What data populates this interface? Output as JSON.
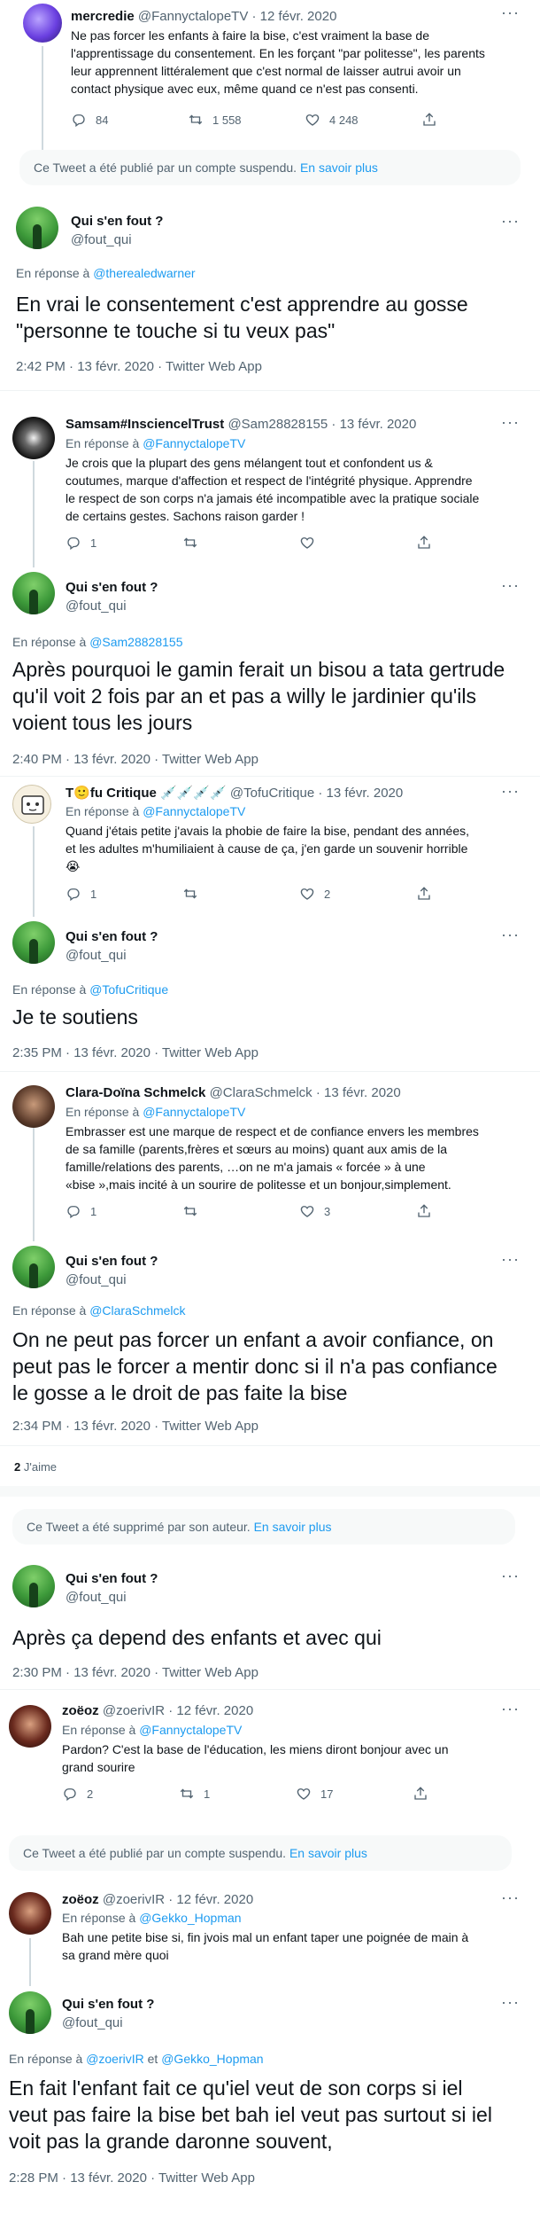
{
  "tweets": {
    "t1": {
      "name": "mercredie",
      "handle": "@FannyctalopeTV",
      "date": "· 12 févr. 2020",
      "lines": [
        "Ne pas forcer les enfants à faire la bise, c'est vraiment la base de",
        "l'apprentissage du consentement. En les forçant \"par politesse\", les parents",
        "leur apprennent littéralement que c'est normal de laisser autrui avoir un",
        "contact physique avec eux, même quand ce n'est pas consenti."
      ],
      "replies": "84",
      "retweets": "1 558",
      "likes": "4 248"
    },
    "notice1": {
      "text": "Ce Tweet a été publié par un compte suspendu.",
      "link": "En savoir plus"
    },
    "f1": {
      "name": "Qui s'en fout ?",
      "handle": "@fout_qui",
      "reply_prefix": "En réponse à",
      "reply_to": "@therealedwarner",
      "lines": [
        "En vrai le consentement c'est apprendre au gosse",
        "\"personne te touche si tu veux pas\""
      ],
      "time": "2:42 PM · 13 févr. 2020 · Twitter Web App"
    },
    "t2": {
      "name": "Samsam#InsciencelTrust",
      "handle": "@Sam28828155",
      "date": "· 13 févr. 2020",
      "reply_prefix": "En réponse à",
      "reply_to": "@FannyctalopeTV",
      "lines": [
        "Je crois que la plupart des gens mélangent tout et confondent us &",
        "coutumes, marque d'affection et respect de l'intégrité physique. Apprendre",
        "le respect de son corps n'a jamais été incompatible avec la pratique sociale",
        "de certains gestes. Sachons raison garder !"
      ],
      "replies": "1",
      "retweets": "",
      "likes": ""
    },
    "f2": {
      "name": "Qui s'en fout ?",
      "handle": "@fout_qui",
      "reply_prefix": "En réponse à",
      "reply_to": "@Sam28828155",
      "lines": [
        "Après pourquoi le gamin ferait un bisou a tata gertrude",
        "qu'il voit 2 fois par an et pas a willy le jardinier qu'ils",
        "voient tous les jours"
      ],
      "time": "2:40 PM · 13 févr. 2020 · Twitter Web App"
    },
    "t3": {
      "name": "T🙂fu Critique 💉💉💉💉",
      "handle": "@TofuCritique",
      "date": "· 13 févr. 2020",
      "reply_prefix": "En réponse à",
      "reply_to": "@FannyctalopeTV",
      "lines": [
        "Quand j'étais petite j'avais la phobie de faire la bise, pendant des années,",
        "et les adultes m'humiliaient à cause de ça, j'en garde un souvenir horrible",
        "😭"
      ],
      "replies": "1",
      "retweets": "",
      "likes": "2"
    },
    "f3": {
      "name": "Qui s'en fout ?",
      "handle": "@fout_qui",
      "reply_prefix": "En réponse à",
      "reply_to": "@TofuCritique",
      "lines": [
        "Je te soutiens"
      ],
      "time": "2:35 PM · 13 févr. 2020 · Twitter Web App"
    },
    "t4": {
      "name": "Clara-Doïna Schmelck",
      "handle": "@ClaraSchmelck",
      "date": "· 13 févr. 2020",
      "reply_prefix": "En réponse à",
      "reply_to": "@FannyctalopeTV",
      "lines": [
        "Embrasser est une marque de respect et de confiance envers les membres",
        "de sa famille (parents,frères et sœurs au moins) quant aux amis de la",
        "famille/relations des parents, …on ne m'a jamais « forcée » à une",
        "«bise »,mais incité à un sourire de politesse et un bonjour,simplement."
      ],
      "replies": "1",
      "retweets": "",
      "likes": "3"
    },
    "f4": {
      "name": "Qui s'en fout ?",
      "handle": "@fout_qui",
      "reply_prefix": "En réponse à",
      "reply_to": "@ClaraSchmelck",
      "lines": [
        "On ne peut pas forcer un enfant a avoir confiance, on",
        "peut pas le forcer a mentir donc si il n'a pas confiance",
        "le gosse a le droit de pas faite la bise"
      ],
      "time": "2:34 PM · 13 févr. 2020 · Twitter Web App",
      "likes_count": "2",
      "likes_label": "J'aime"
    },
    "notice2": {
      "text": "Ce Tweet a été supprimé par son auteur.",
      "link": "En savoir plus"
    },
    "f5": {
      "name": "Qui s'en fout ?",
      "handle": "@fout_qui",
      "lines": [
        "Après ça depend des enfants et avec qui"
      ],
      "time": "2:30 PM · 13 févr. 2020 · Twitter Web App"
    },
    "t5": {
      "name": "zoëoz",
      "handle": "@zoerivIR",
      "date": "· 12 févr. 2020",
      "reply_prefix": "En réponse à",
      "reply_to": "@FannyctalopeTV",
      "lines": [
        "Pardon? C'est la base de l'éducation, les miens diront bonjour avec un",
        "grand sourire"
      ],
      "replies": "2",
      "retweets": "1",
      "likes": "17"
    },
    "notice3": {
      "text": "Ce Tweet a été publié par un compte suspendu.",
      "link": "En savoir plus"
    },
    "t6": {
      "name": "zoëoz",
      "handle": "@zoerivIR",
      "date": "· 12 févr. 2020",
      "reply_prefix": "En réponse à",
      "reply_to": "@Gekko_Hopman",
      "lines": [
        "Bah une petite bise si, fin jvois mal un enfant taper une poignée de main à",
        "sa grand mère quoi"
      ]
    },
    "f6": {
      "name": "Qui s'en fout ?",
      "handle": "@fout_qui",
      "reply_prefix": "En réponse à",
      "reply_to": "@zoerivIR",
      "reply_and": "et",
      "reply_to2": "@Gekko_Hopman",
      "lines": [
        "En fait l'enfant fait ce qu'iel veut de son corps si iel",
        "veut pas faire la bise bet bah iel veut pas surtout si iel",
        "voit pas la grande daronne souvent,"
      ],
      "time": "2:28 PM · 13 févr. 2020 · Twitter Web App"
    }
  },
  "icons": {
    "reply": "reply-icon",
    "retweet": "retweet-icon",
    "like": "heart-icon",
    "share": "share-icon",
    "more": "more-icon"
  }
}
